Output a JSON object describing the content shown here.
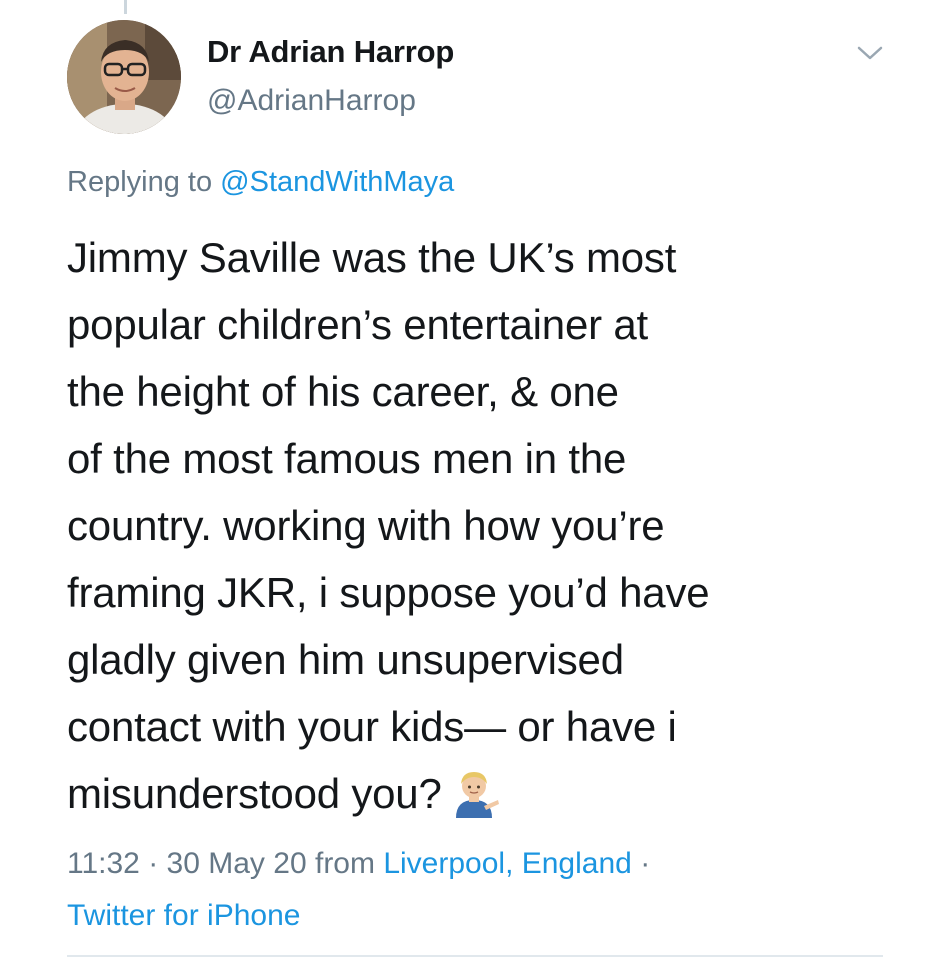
{
  "tweet": {
    "author": {
      "display_name": "Dr Adrian Harrop",
      "handle": "@AdrianHarrop"
    },
    "reply": {
      "prefix": "Replying to",
      "mention": "@StandWithMaya"
    },
    "text_lines": [
      "Jimmy Saville was the UK’s most",
      "popular children’s entertainer at",
      "the height of his career, & one",
      "of the most famous men in the",
      "country. working with how you’re",
      "framing JKR, i suppose you’d have",
      "gladly given him unsupervised",
      "contact with your kids— or have i",
      "misunderstood you?"
    ],
    "emoji": "man-tipping-hand-emoji",
    "meta": {
      "time": "11:32",
      "separator": "·",
      "date": "30 May 20",
      "from_label": "from",
      "location": "Liverpool, England",
      "source": "Twitter for iPhone"
    }
  },
  "colors": {
    "text": "#14171a",
    "secondary": "#657786",
    "link": "#1b95e0",
    "divider": "#e1e8ed"
  },
  "icons": {
    "menu": "chevron-down-icon"
  }
}
